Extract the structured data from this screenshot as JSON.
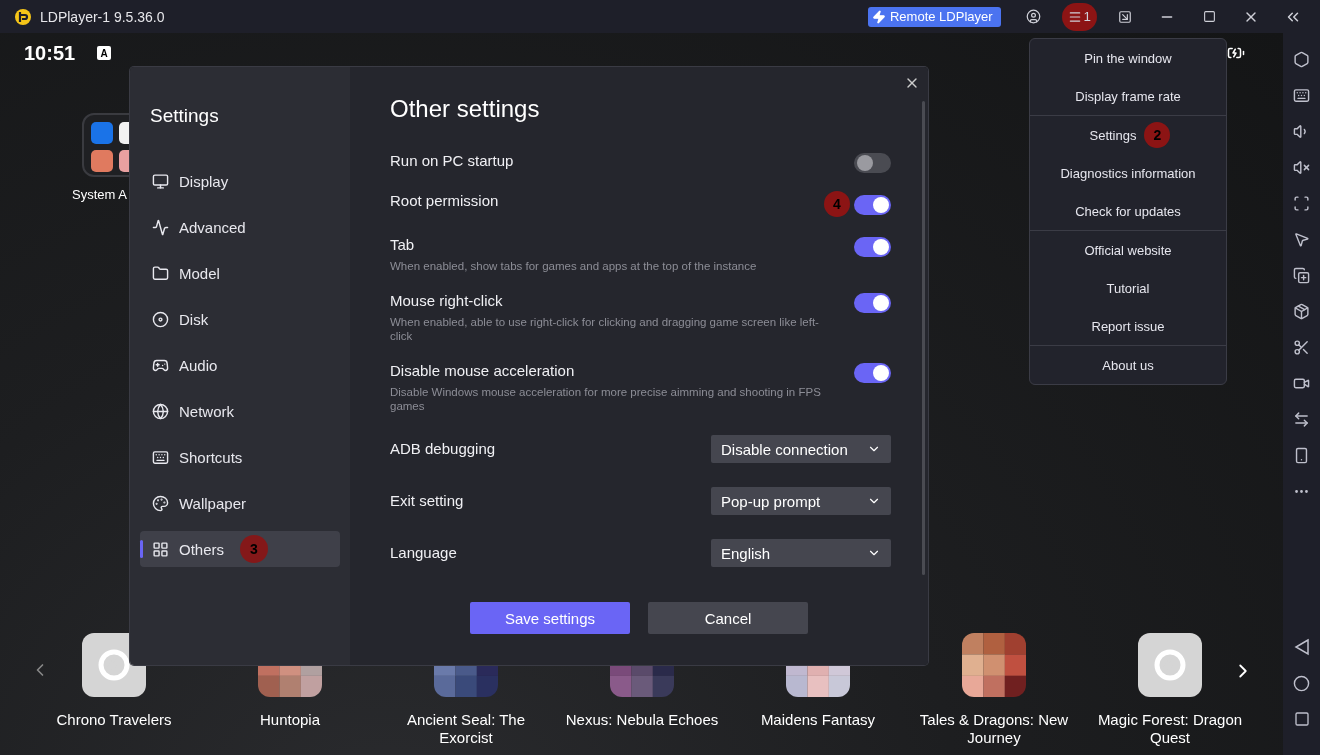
{
  "window": {
    "title": "LDPlayer-1 9.5.36.0",
    "remote_button": "Remote LDPlayer",
    "menu_marker": "1"
  },
  "status_bar": {
    "time": "10:51",
    "keyboard_badge": "A"
  },
  "desktop": {
    "folder_label": "System A"
  },
  "settings": {
    "title": "Settings",
    "heading": "Other settings",
    "nav": [
      {
        "label": "Display",
        "selected": false
      },
      {
        "label": "Advanced",
        "selected": false
      },
      {
        "label": "Model",
        "selected": false
      },
      {
        "label": "Disk",
        "selected": false
      },
      {
        "label": "Audio",
        "selected": false
      },
      {
        "label": "Network",
        "selected": false
      },
      {
        "label": "Shortcuts",
        "selected": false
      },
      {
        "label": "Wallpaper",
        "selected": false
      },
      {
        "label": "Others",
        "selected": true,
        "marker": "3"
      }
    ],
    "rows": [
      {
        "kind": "toggle",
        "label": "Run on PC startup",
        "on": false
      },
      {
        "kind": "toggle",
        "label": "Root permission",
        "on": true,
        "marker": "4"
      },
      {
        "kind": "toggle",
        "label": "Tab",
        "on": true,
        "description": "When enabled, show tabs for games and apps at the top of the instance"
      },
      {
        "kind": "toggle",
        "label": "Mouse right-click",
        "on": true,
        "description": "When enabled, able to use right-click for clicking and dragging game screen like left-click"
      },
      {
        "kind": "toggle",
        "label": "Disable mouse acceleration",
        "on": true,
        "description": "Disable Windows mouse acceleration for more precise aimming and shooting in FPS games"
      },
      {
        "kind": "select",
        "label": "ADB debugging",
        "value": "Disable connection"
      },
      {
        "kind": "select",
        "label": "Exit setting",
        "value": "Pop-up prompt"
      },
      {
        "kind": "select",
        "label": "Language",
        "value": "English"
      }
    ],
    "buttons": [
      "Save settings",
      "Cancel"
    ]
  },
  "menu": {
    "groups": [
      [
        {
          "label": "Pin the window"
        },
        {
          "label": "Display frame rate"
        }
      ],
      [
        {
          "label": "Settings",
          "marker": "2"
        },
        {
          "label": "Diagnostics information"
        },
        {
          "label": "Check for updates"
        }
      ],
      [
        {
          "label": "Official website"
        },
        {
          "label": "Tutorial"
        },
        {
          "label": "Report issue"
        }
      ],
      [
        {
          "label": "About us"
        }
      ]
    ]
  },
  "apps": [
    {
      "kind": "placeholder",
      "label": "Chrono Travelers"
    },
    {
      "kind": "picture",
      "label": "Huntopia"
    },
    {
      "kind": "picture",
      "label": "Ancient Seal: The Exorcist"
    },
    {
      "kind": "picture",
      "label": "Nexus: Nebula Echoes"
    },
    {
      "kind": "picture",
      "label": "Maidens Fantasy"
    },
    {
      "kind": "picture",
      "label": "Tales & Dragons: New Journey"
    },
    {
      "kind": "placeholder",
      "label": "Magic Forest: Dragon Quest"
    }
  ]
}
